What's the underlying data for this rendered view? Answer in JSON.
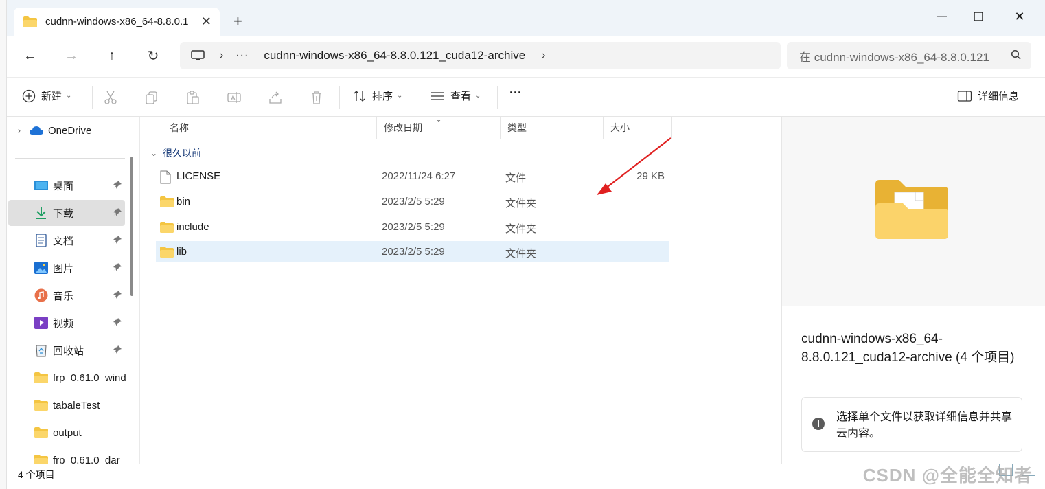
{
  "window": {
    "tab_title": "cudnn-windows-x86_64-8.8.0.121_cuda12-archive",
    "tab_title_visible": "cudnn-windows-x86_64-8.8.0.1",
    "new_tab": "+",
    "minimize": "—",
    "close": "✕"
  },
  "nav": {
    "back": "←",
    "forward": "→",
    "up": "↑",
    "refresh": "↻",
    "sep": "›",
    "more": "···",
    "path": "cudnn-windows-x86_64-8.8.0.121_cuda12-archive",
    "search_placeholder": "在 cudnn-windows-x86_64-8.8.0.121"
  },
  "toolbar": {
    "new_label": "新建",
    "sort_label": "排序",
    "view_label": "查看",
    "more": "···",
    "details_label": "详细信息"
  },
  "sidebar": {
    "onedrive": "OneDrive",
    "items": [
      {
        "label": "桌面",
        "icon": "desktop-icon",
        "pinned": true
      },
      {
        "label": "下载",
        "icon": "download-icon",
        "pinned": true,
        "selected": true
      },
      {
        "label": "文档",
        "icon": "document-icon",
        "pinned": true
      },
      {
        "label": "图片",
        "icon": "pictures-icon",
        "pinned": true
      },
      {
        "label": "音乐",
        "icon": "music-icon",
        "pinned": true
      },
      {
        "label": "视频",
        "icon": "video-icon",
        "pinned": true
      },
      {
        "label": "回收站",
        "icon": "recycle-bin-icon",
        "pinned": true
      },
      {
        "label": "frp_0.61.0_wind",
        "icon": "folder-icon"
      },
      {
        "label": "tabaleTest",
        "icon": "folder-icon"
      },
      {
        "label": "output",
        "icon": "folder-icon"
      },
      {
        "label": "frp_0.61.0_dar",
        "icon": "folder-icon"
      }
    ]
  },
  "list": {
    "columns": [
      "名称",
      "修改日期",
      "类型",
      "大小"
    ],
    "group": "很久以前",
    "rows": [
      {
        "name": "LICENSE",
        "date": "2022/11/24 6:27",
        "type": "文件",
        "size": "29 KB",
        "icon": "file-icon"
      },
      {
        "name": "bin",
        "date": "2023/2/5 5:29",
        "type": "文件夹",
        "size": "",
        "icon": "folder-icon"
      },
      {
        "name": "include",
        "date": "2023/2/5 5:29",
        "type": "文件夹",
        "size": "",
        "icon": "folder-icon"
      },
      {
        "name": "lib",
        "date": "2023/2/5 5:29",
        "type": "文件夹",
        "size": "",
        "icon": "folder-icon",
        "selected": true
      }
    ]
  },
  "details": {
    "title": "cudnn-windows-x86_64-8.8.0.121_cuda12-archive (4 个项目)",
    "info": "选择单个文件以获取详细信息并共享云内容。"
  },
  "status": {
    "count": "4 个项目"
  },
  "watermark": "CSDN @全能全知者",
  "colors": {
    "titlebar": "#eff4f9",
    "selection": "#e5f1fb",
    "folder": "#f4c542",
    "arrow": "#e02020"
  }
}
